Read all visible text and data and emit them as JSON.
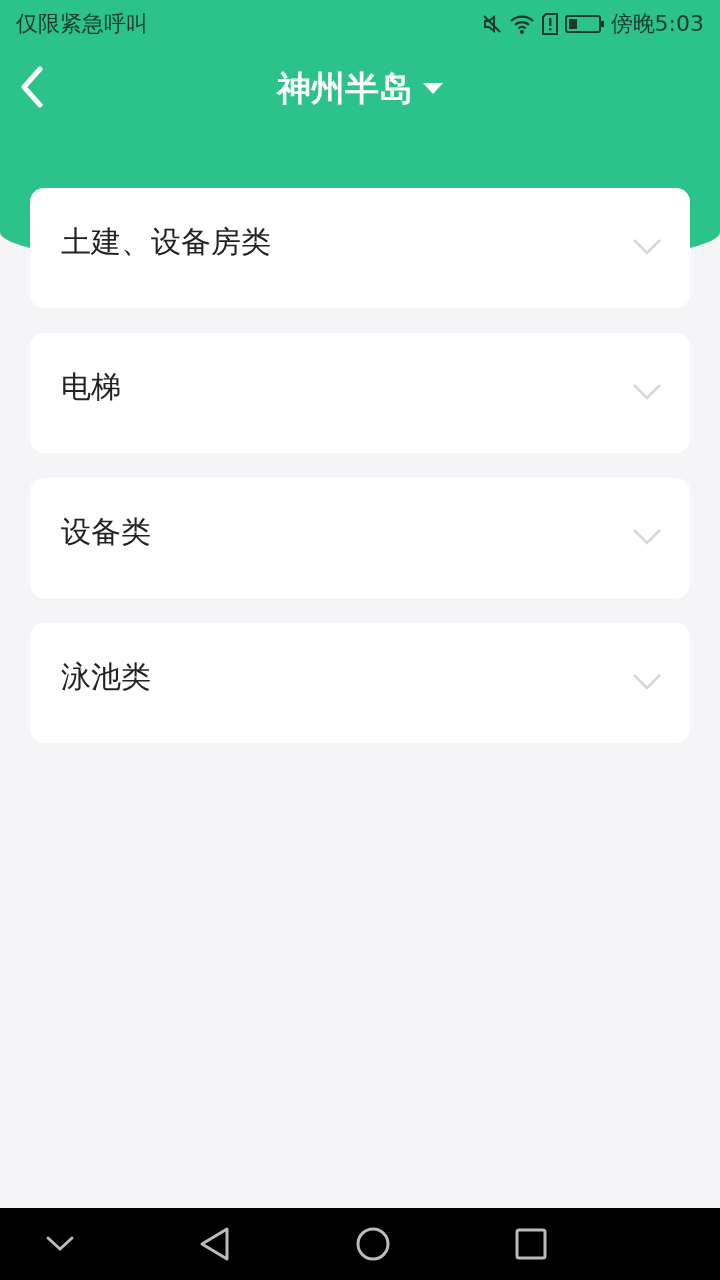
{
  "status_bar": {
    "carrier": "仅限紧急呼叫",
    "time": "傍晚5:03"
  },
  "header": {
    "title": "神州半岛"
  },
  "categories": [
    {
      "label": "土建、设备房类",
      "expanded": false
    },
    {
      "label": "电梯",
      "expanded": false
    },
    {
      "label": "设备类",
      "expanded": false
    },
    {
      "label": "泳池类",
      "expanded": false
    }
  ]
}
